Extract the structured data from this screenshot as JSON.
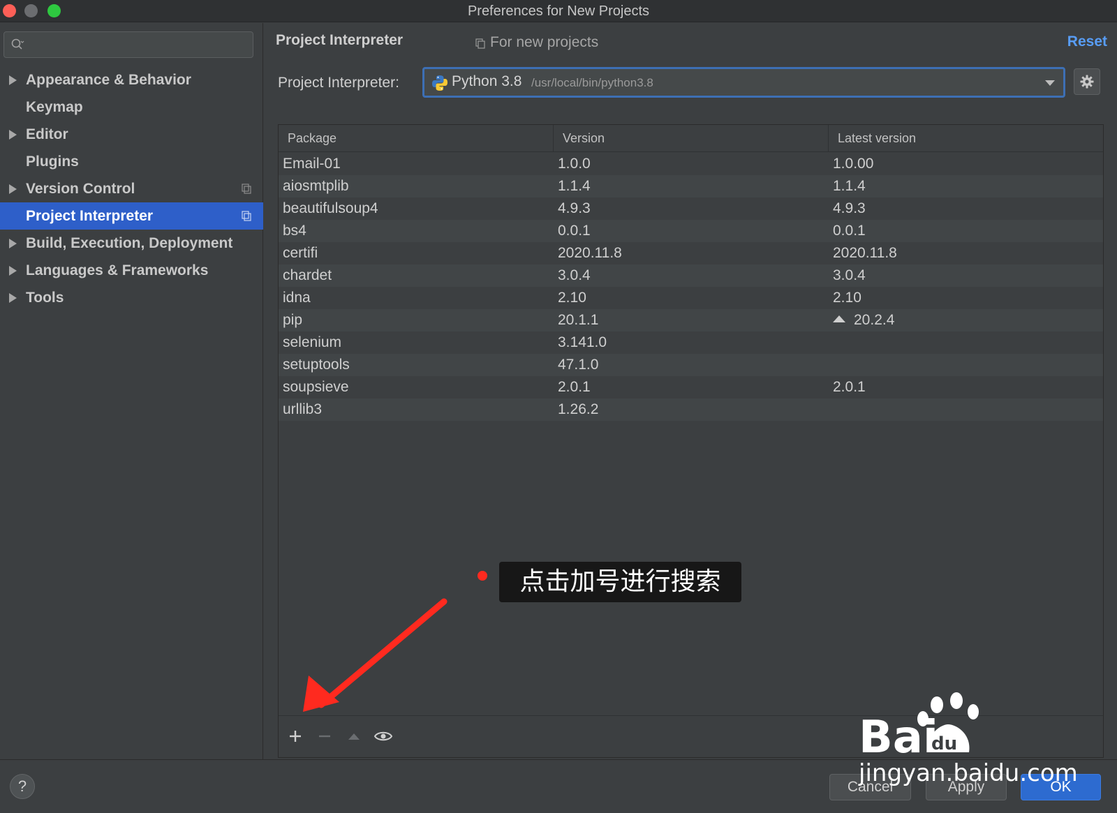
{
  "window": {
    "title": "Preferences for New Projects"
  },
  "sidebar": {
    "search_placeholder": "",
    "items": [
      {
        "label": "Appearance & Behavior",
        "expandable": true,
        "selected": false,
        "copy_icon": false
      },
      {
        "label": "Keymap",
        "expandable": false,
        "selected": false,
        "copy_icon": false
      },
      {
        "label": "Editor",
        "expandable": true,
        "selected": false,
        "copy_icon": false
      },
      {
        "label": "Plugins",
        "expandable": false,
        "selected": false,
        "copy_icon": false
      },
      {
        "label": "Version Control",
        "expandable": true,
        "selected": false,
        "copy_icon": true
      },
      {
        "label": "Project Interpreter",
        "expandable": false,
        "selected": true,
        "copy_icon": true
      },
      {
        "label": "Build, Execution, Deployment",
        "expandable": true,
        "selected": false,
        "copy_icon": false
      },
      {
        "label": "Languages & Frameworks",
        "expandable": true,
        "selected": false,
        "copy_icon": false
      },
      {
        "label": "Tools",
        "expandable": true,
        "selected": false,
        "copy_icon": false
      }
    ]
  },
  "main": {
    "title": "Project Interpreter",
    "scope_label": "For new projects",
    "reset_label": "Reset",
    "interpreter_label": "Project Interpreter:",
    "interpreter_name": "Python 3.8",
    "interpreter_path": "/usr/local/bin/python3.8"
  },
  "table": {
    "columns": [
      "Package",
      "Version",
      "Latest version"
    ],
    "rows": [
      {
        "package": "Email-01",
        "version": "1.0.0",
        "latest": "1.0.00",
        "upgrade": false
      },
      {
        "package": "aiosmtplib",
        "version": "1.1.4",
        "latest": "1.1.4",
        "upgrade": false
      },
      {
        "package": "beautifulsoup4",
        "version": "4.9.3",
        "latest": "4.9.3",
        "upgrade": false
      },
      {
        "package": "bs4",
        "version": "0.0.1",
        "latest": "0.0.1",
        "upgrade": false
      },
      {
        "package": "certifi",
        "version": "2020.11.8",
        "latest": "2020.11.8",
        "upgrade": false
      },
      {
        "package": "chardet",
        "version": "3.0.4",
        "latest": "3.0.4",
        "upgrade": false
      },
      {
        "package": "idna",
        "version": "2.10",
        "latest": "2.10",
        "upgrade": false
      },
      {
        "package": "pip",
        "version": "20.1.1",
        "latest": "20.2.4",
        "upgrade": true
      },
      {
        "package": "selenium",
        "version": "3.141.0",
        "latest": "",
        "upgrade": false
      },
      {
        "package": "setuptools",
        "version": "47.1.0",
        "latest": "",
        "upgrade": false
      },
      {
        "package": "soupsieve",
        "version": "2.0.1",
        "latest": "2.0.1",
        "upgrade": false
      },
      {
        "package": "urllib3",
        "version": "1.26.2",
        "latest": "",
        "upgrade": false
      }
    ]
  },
  "annotation": {
    "text": "点击加号进行搜索",
    "color": "#ff2a1f"
  },
  "footer": {
    "help_label": "?",
    "cancel_label": "Cancel",
    "apply_label": "Apply",
    "ok_label": "OK"
  },
  "watermark": {
    "url": "jingyan.baidu.com"
  },
  "colors": {
    "selection": "#2e5fc9",
    "link": "#589df6",
    "background": "#3c3f41"
  }
}
